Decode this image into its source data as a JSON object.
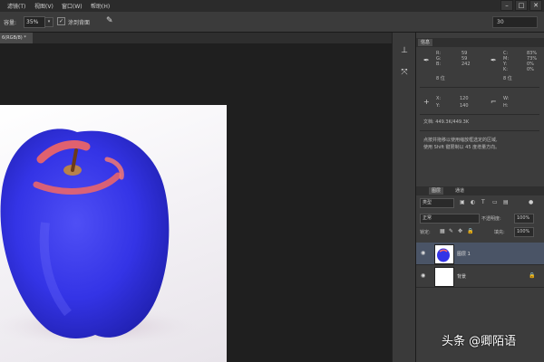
{
  "menubar": {
    "items": [
      "滤镜(T)",
      "视图(V)",
      "窗口(W)",
      "帮助(H)"
    ],
    "window_controls": [
      "–",
      "□",
      "✕"
    ]
  },
  "options": {
    "opacity_label": "容量:",
    "opacity_value": "35%",
    "erase_label": "涂到背面",
    "erase_checked": "✓",
    "right_field_value": "30"
  },
  "document": {
    "tab_label": "6(RGB/8) *"
  },
  "tools": {
    "icons": [
      "stamp-tool-icon",
      "crop-tool-icon"
    ]
  },
  "info_panel": {
    "tab_label": "信息",
    "rgb": [
      {
        "label": "R:",
        "value": "59"
      },
      {
        "label": "G:",
        "value": "59"
      },
      {
        "label": "B:",
        "value": "242"
      }
    ],
    "cmyk": [
      {
        "label": "C:",
        "value": "83%"
      },
      {
        "label": "M:",
        "value": "73%"
      },
      {
        "label": "Y:",
        "value": "0%"
      },
      {
        "label": "K:",
        "value": "0%"
      }
    ],
    "bit_left": "8 位",
    "bit_right": "8 位",
    "x_label": "X:",
    "x_value": "120",
    "y_label": "Y:",
    "y_value": "140",
    "w_label": "W:",
    "h_label": "H:",
    "doc_size": "文档: 449.3K/449.3K",
    "hint_line1": "点按并拖移以使用缩放框选定的区域,",
    "hint_line2": "使用 Shift 键限制以 45 度增量方向。"
  },
  "layers_panel": {
    "tabs": [
      "图层",
      "通道"
    ],
    "filter_label": "类型",
    "blend_mode": "正常",
    "opacity_label": "不透明度:",
    "opacity_value": "100%",
    "lock_label": "锁定:",
    "fill_label": "填充:",
    "fill_value": "100%",
    "layers": [
      {
        "name": "图层 1",
        "selected": true
      },
      {
        "name": "背景",
        "selected": false
      }
    ]
  },
  "watermark": {
    "text": "头条 @卿陌语"
  },
  "colors": {
    "apple_blue": "#3636e8",
    "apple_highlight": "#ff6a5a",
    "selected_layer": "#4a5466"
  }
}
